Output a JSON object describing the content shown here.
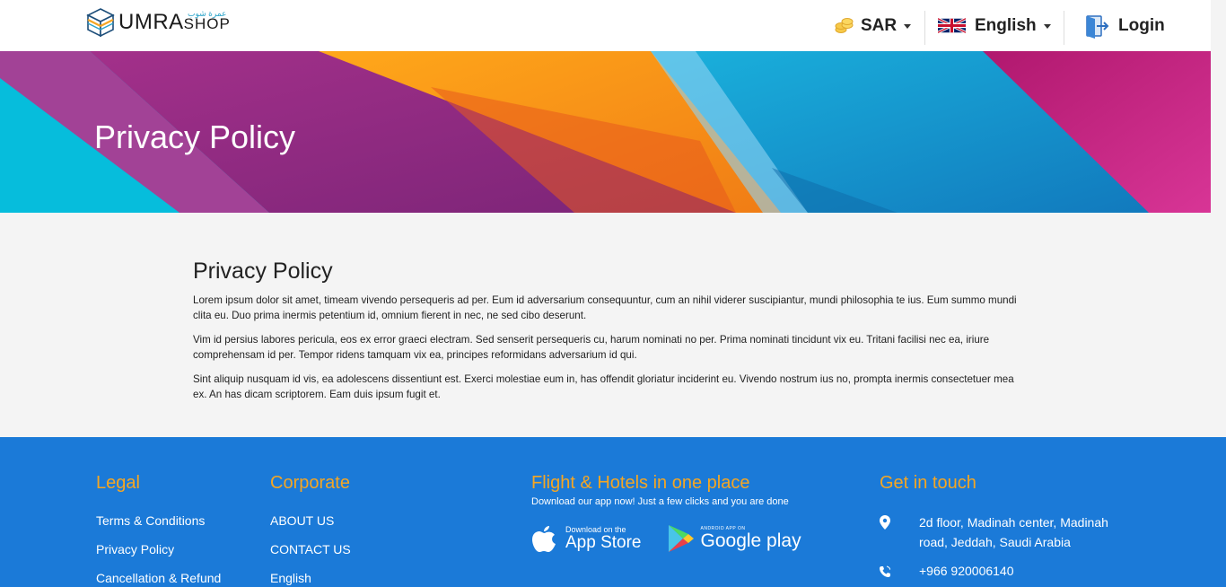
{
  "header": {
    "logo_main": "UMRA",
    "logo_sub": "SHOP",
    "logo_arabic": "عمرة شوب",
    "currency": "SAR",
    "language": "English",
    "login": "Login"
  },
  "banner": {
    "title": "Privacy Policy"
  },
  "content": {
    "heading": "Privacy Policy",
    "paragraphs": [
      "Lorem ipsum dolor sit amet, timeam vivendo persequeris ad per. Eum id adversarium consequuntur, cum an nihil viderer suscipiantur, mundi philosophia te ius. Eum summo mundi clita eu. Duo prima inermis petentium id, omnium fierent in nec, ne sed cibo deserunt.",
      "Vim id persius labores pericula, eos ex error graeci electram. Sed senserit persequeris cu, harum nominati no per. Prima nominati tincidunt vix eu. Tritani facilisi nec ea, iriure comprehensam id per. Tempor ridens tamquam vix ea, principes reformidans adversarium id qui.",
      "Sint aliquip nusquam id vis, ea adolescens dissentiunt est. Exerci molestiae eum in, has offendit gloriatur inciderint eu. Vivendo nostrum ius no, prompta inermis consectetuer mea ex. An has dicam scriptorem. Eam duis ipsum fugit et."
    ]
  },
  "footer": {
    "legal": {
      "title": "Legal",
      "links": [
        "Terms & Conditions",
        "Privacy Policy",
        "Cancellation & Refund"
      ]
    },
    "corporate": {
      "title": "Corporate",
      "links": [
        "ABOUT US",
        "CONTACT US",
        "English"
      ]
    },
    "app": {
      "title": "Flight & Hotels in one place",
      "subtitle": "Download our app now! Just a few clicks and you are done",
      "appstore_small": "Download on the",
      "appstore_big": "App Store",
      "googleplay_small": "ANDROID APP ON",
      "googleplay_big": "Google play"
    },
    "contact": {
      "title": "Get in touch",
      "address": "2d floor, Madinah center, Madinah road, Jeddah, Saudi Arabia",
      "phone": "+966 920006140"
    }
  },
  "colors": {
    "footer_bg": "#1b7ad8",
    "footer_title": "#f5a623",
    "banner_purple": "#8e2a7a",
    "banner_orange": "#f7931e",
    "banner_cyan": "#1ba8d8"
  }
}
